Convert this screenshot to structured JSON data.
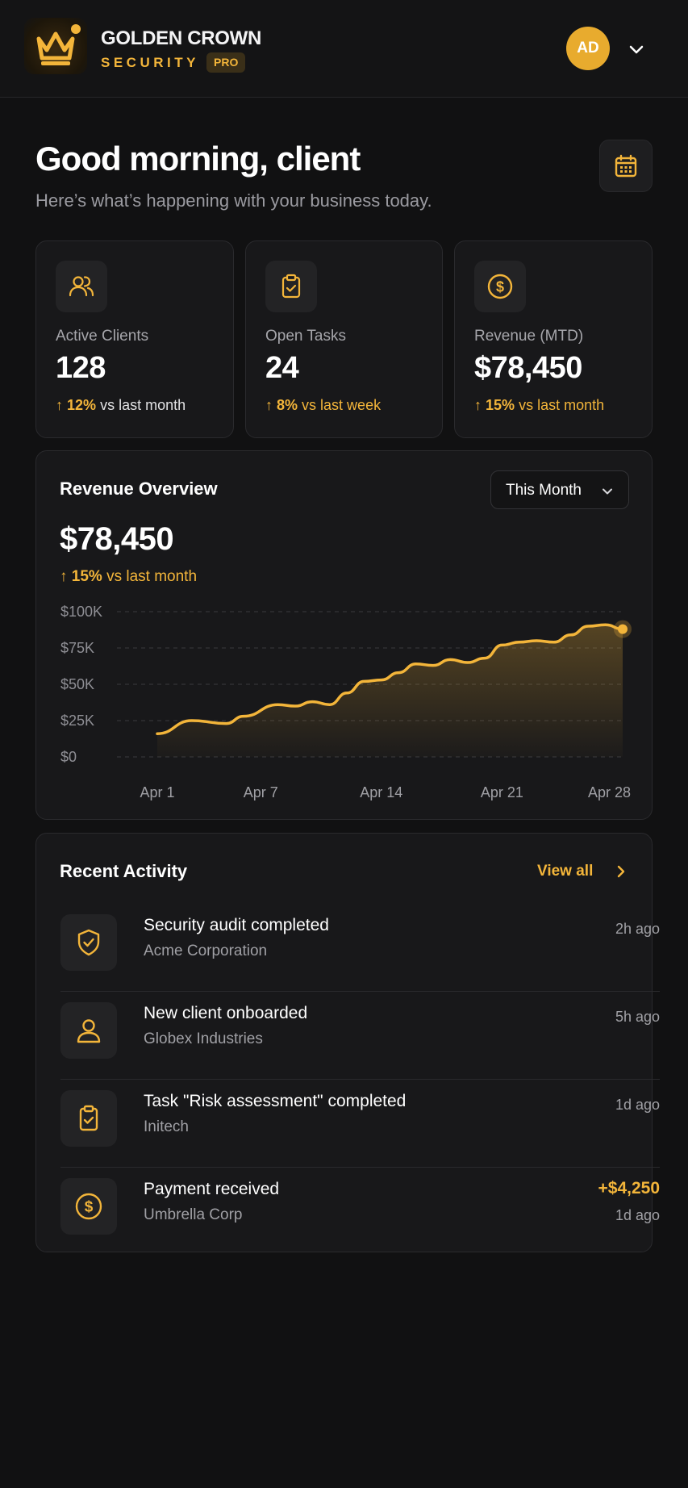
{
  "header": {
    "brand_title": "GOLDEN CROWN",
    "brand_subtitle": "SECURITY",
    "badge": "PRO",
    "avatar_initials": "AD",
    "icons": {
      "logo": "crown-icon",
      "menu": "chevron-down-icon"
    }
  },
  "greeting": {
    "title": "Good morning, client",
    "subtitle": "Here’s what’s happening with your business today.",
    "calendar_icon": "calendar-icon"
  },
  "stats": [
    {
      "label": "Active Clients",
      "value": "128",
      "delta": "12%",
      "context": "vs last month",
      "icon": "users-icon"
    },
    {
      "label": "Open Tasks",
      "value": "24",
      "delta": "8%",
      "context": "vs last week",
      "icon": "clipboard-check-icon"
    },
    {
      "label": "Revenue (MTD)",
      "value": "$78,450",
      "delta": "15%",
      "context": "vs last month",
      "icon": "dollar-circle-icon"
    }
  ],
  "revenue": {
    "title": "Revenue Overview",
    "period": "This Month",
    "value": "$78,450",
    "delta": "15%",
    "context": "vs last month"
  },
  "chart_data": {
    "type": "area",
    "title": "Revenue Overview",
    "x_ticks": [
      "Apr 1",
      "Apr 7",
      "Apr 14",
      "Apr 21",
      "Apr 28"
    ],
    "y_ticks": [
      "$0",
      "$25K",
      "$50K",
      "$75K",
      "$100K"
    ],
    "ylim": [
      0,
      100000
    ],
    "xlim": [
      1,
      28
    ],
    "grid": true,
    "x": [
      1,
      3,
      5,
      6,
      8,
      9,
      10,
      11,
      12,
      13,
      14,
      15,
      16,
      17,
      18,
      19,
      20,
      21,
      22,
      23,
      24,
      25,
      26,
      27,
      28
    ],
    "values": [
      16000,
      25000,
      23000,
      28000,
      36000,
      35000,
      38000,
      36000,
      44000,
      52000,
      53000,
      58000,
      64000,
      63000,
      67000,
      65000,
      68000,
      77000,
      79000,
      80000,
      79000,
      84000,
      90000,
      91000,
      88000
    ],
    "colors": {
      "line": "#f3b53a",
      "fill": "#f3b53a"
    }
  },
  "activity": {
    "title": "Recent Activity",
    "view_all": "View all",
    "items": [
      {
        "title": "Security audit completed",
        "subtitle": "Acme Corporation",
        "time": "2h ago",
        "icon": "shield-check-icon"
      },
      {
        "title": "New client onboarded",
        "subtitle": "Globex Industries",
        "time": "5h ago",
        "icon": "user-icon"
      },
      {
        "title": "Task \"Risk assessment\" completed",
        "subtitle": "Initech",
        "time": "1d ago",
        "icon": "clipboard-check-icon"
      },
      {
        "title": "Payment received",
        "subtitle": "Umbrella Corp",
        "amount": "+$4,250",
        "time": "1d ago",
        "icon": "dollar-circle-icon"
      }
    ]
  },
  "colors": {
    "accent": "#f3b53a",
    "background": "#111112",
    "card": "#18181a"
  }
}
